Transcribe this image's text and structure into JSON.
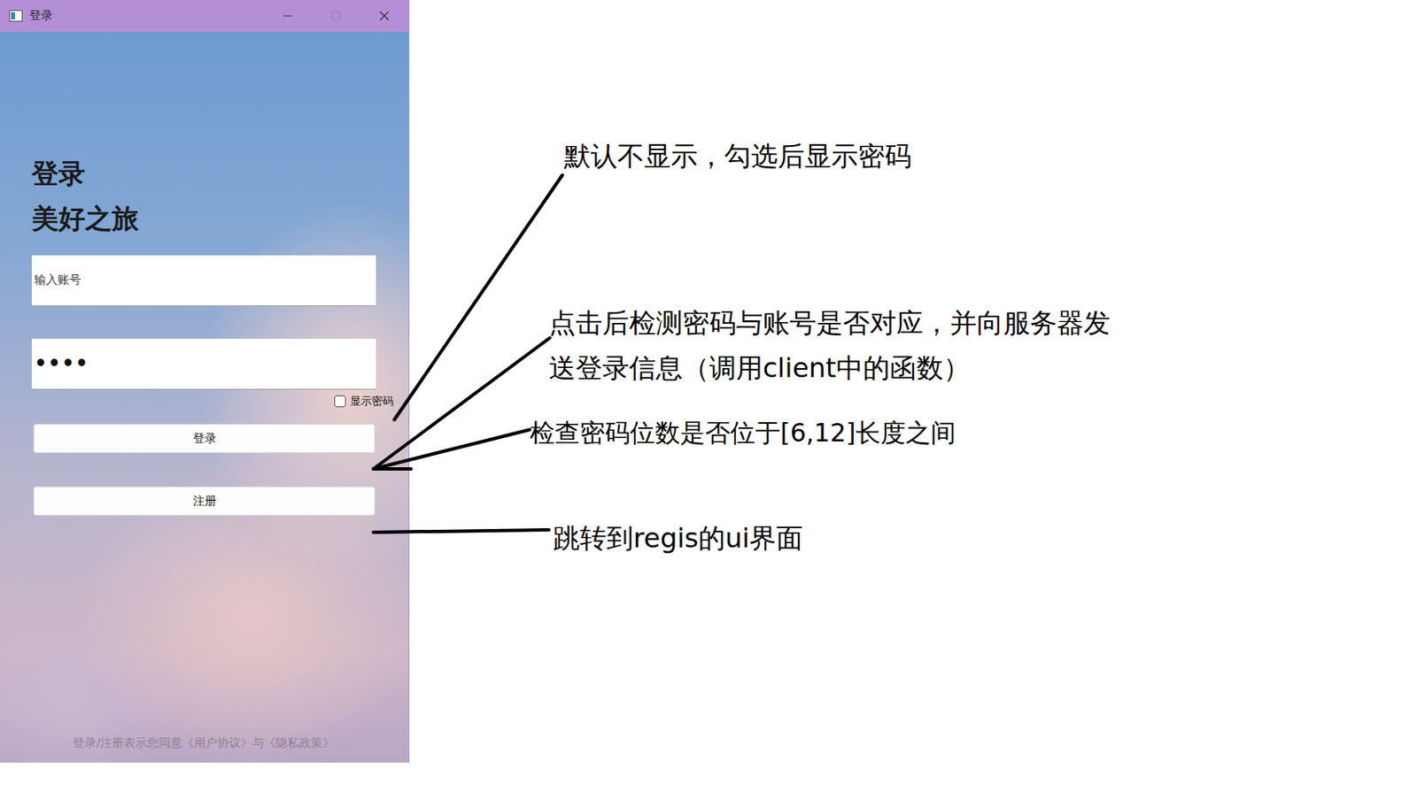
{
  "window": {
    "title": "登录"
  },
  "headings": [
    "登录",
    "美好之旅"
  ],
  "account": {
    "placeholder": "输入账号",
    "value": ""
  },
  "password": {
    "value": "••••"
  },
  "show_password": {
    "label": "显示密码",
    "checked": false
  },
  "buttons": [
    {
      "label": "登录"
    },
    {
      "label": "注册"
    }
  ],
  "footer": "登录/注册表示您同意《用户协议》与《隐私政策》",
  "annotations": [
    {
      "lines": [
        "默认不显示，勾选后显示密码"
      ]
    },
    {
      "lines": [
        "点击后检测密码与账号是否对应，并向服务器发",
        "送登录信息（调用client中的函数）"
      ]
    },
    {
      "lines": [
        "检查密码位数是否位于[6,12]长度之间"
      ]
    },
    {
      "lines": [
        "跳转到regis的ui界面"
      ]
    }
  ]
}
